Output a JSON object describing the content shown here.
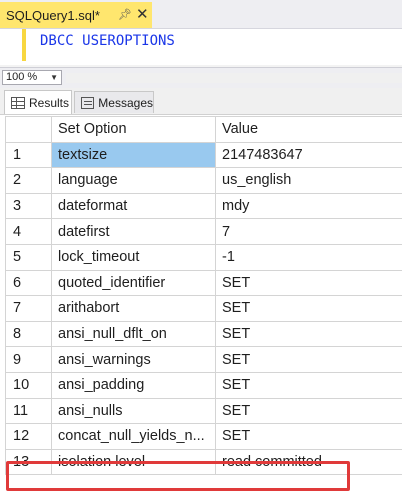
{
  "document_tab": {
    "title": "SQLQuery1.sql*",
    "pin_icon": "pin-icon",
    "close_icon": "close-icon",
    "accent": "#ffe66e"
  },
  "editor": {
    "query": "DBCC USEROPTIONS",
    "text_color": "#1a36e8"
  },
  "zoom": {
    "value": "100 %"
  },
  "result_tabs": [
    {
      "label": "Results",
      "icon": "grid-icon",
      "active": true
    },
    {
      "label": "Messages",
      "icon": "messages-icon",
      "active": false
    }
  ],
  "grid": {
    "columns": [
      "",
      "Set Option",
      "Value"
    ],
    "rows": [
      {
        "n": "1",
        "option": "textsize",
        "value": "2147483647"
      },
      {
        "n": "2",
        "option": "language",
        "value": "us_english"
      },
      {
        "n": "3",
        "option": "dateformat",
        "value": "mdy"
      },
      {
        "n": "4",
        "option": "datefirst",
        "value": "7"
      },
      {
        "n": "5",
        "option": "lock_timeout",
        "value": "-1"
      },
      {
        "n": "6",
        "option": "quoted_identifier",
        "value": "SET"
      },
      {
        "n": "7",
        "option": "arithabort",
        "value": "SET"
      },
      {
        "n": "8",
        "option": "ansi_null_dflt_on",
        "value": "SET"
      },
      {
        "n": "9",
        "option": "ansi_warnings",
        "value": "SET"
      },
      {
        "n": "10",
        "option": "ansi_padding",
        "value": "SET"
      },
      {
        "n": "11",
        "option": "ansi_nulls",
        "value": "SET"
      },
      {
        "n": "12",
        "option": "concat_null_yields_n...",
        "value": "SET"
      },
      {
        "n": "13",
        "option": "isolation level",
        "value": "read committed"
      }
    ],
    "selected_cell": "row 1, Set Option",
    "highlight_color": "#e03a3a"
  }
}
